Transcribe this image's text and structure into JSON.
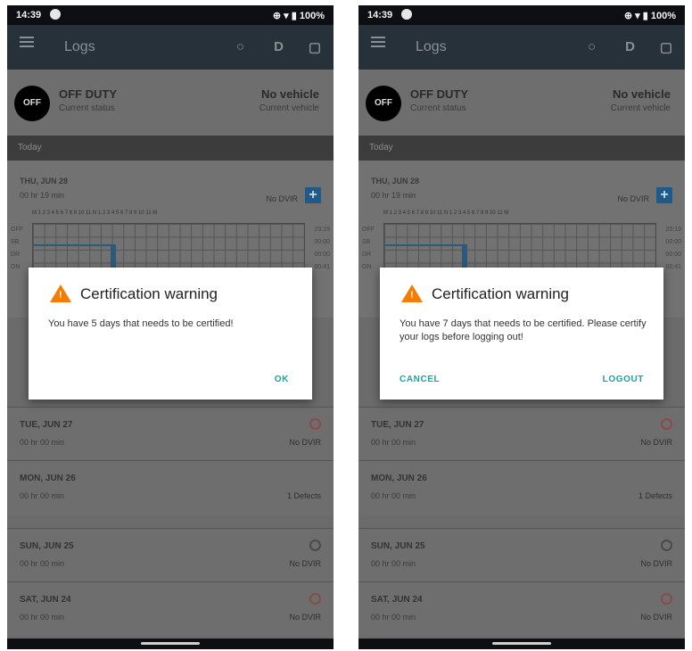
{
  "status_bar": {
    "time": "14:39",
    "right": "⊕ ▾ ▮ 100%"
  },
  "app_bar": {
    "title": "Logs"
  },
  "duty": {
    "badge": "OFF",
    "status": "OFF DUTY",
    "status_caption": "Current status",
    "vehicle": "No vehicle",
    "vehicle_caption": "Current vehicle"
  },
  "section_title": "Today",
  "today": {
    "date": "THU, JUN 28",
    "duration": "00 hr 19 min",
    "diagnostics": "No DVIR",
    "grid_hours": "M 1 2 3 4 5 6 7 8 9 10 11 N 1 2 3 4 5 6 7 8 9 10 11 M",
    "row_labels": [
      "OFF",
      "SB",
      "DR",
      "ON"
    ],
    "row_totals": [
      "23:19",
      "00:00",
      "00:00",
      "00:41"
    ]
  },
  "days": [
    {
      "date": "TUE, JUN 27",
      "duration": "00 hr 00 min",
      "dvir": "No DVIR"
    },
    {
      "date": "MON, JUN 26",
      "duration": "00 hr 00 min",
      "dvir": "1 Defects"
    },
    {
      "date": "SUN, JUN 25",
      "duration": "00 hr 00 min",
      "dvir": "No DVIR"
    },
    {
      "date": "SAT, JUN 24",
      "duration": "00 hr 00 min",
      "dvir": "No DVIR"
    }
  ],
  "dialog_left": {
    "title": "Certification warning",
    "message": "You have 5 days that needs to be certified!",
    "ok": "OK"
  },
  "dialog_right": {
    "title": "Certification warning",
    "message": "You have 7 days that needs to be certified. Please certify your logs before logging out!",
    "cancel": "CANCEL",
    "logout": "LOGOUT"
  },
  "colors": {
    "accent": "#1aa59a",
    "warning": "#f57c00",
    "app_bar": "#27313a"
  }
}
